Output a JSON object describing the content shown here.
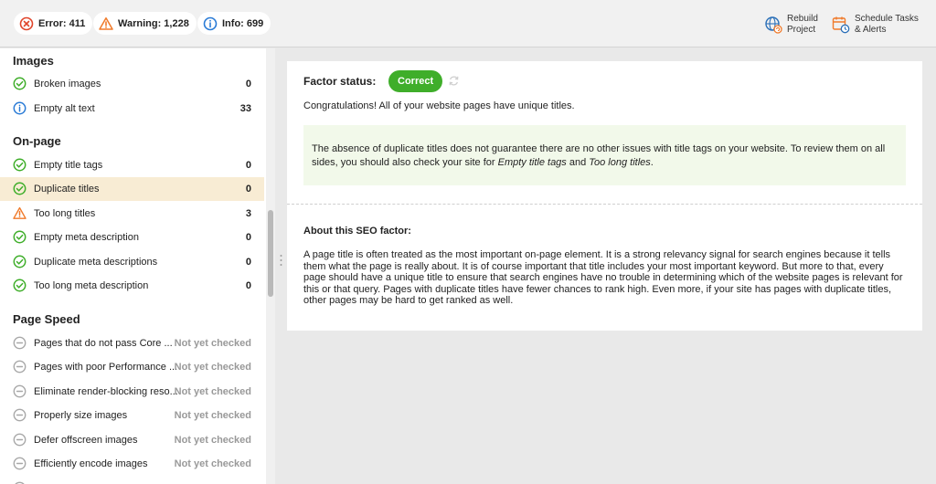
{
  "topbar": {
    "error": {
      "label": "Error: 411"
    },
    "warning": {
      "label": "Warning: 1,228"
    },
    "info": {
      "label": "Info: 699"
    },
    "rebuild": {
      "line1": "Rebuild",
      "line2": "Project",
      "icon": "globe-refresh-icon"
    },
    "schedule": {
      "line1": "Schedule Tasks",
      "line2": "& Alerts",
      "icon": "calendar-clock-icon"
    }
  },
  "sidebar": {
    "images": {
      "title": "Images",
      "items": [
        {
          "label": "Broken images",
          "count": "0",
          "status": "ok"
        },
        {
          "label": "Empty alt text",
          "count": "33",
          "status": "info"
        }
      ]
    },
    "onpage": {
      "title": "On-page",
      "items": [
        {
          "label": "Empty title tags",
          "count": "0",
          "status": "ok"
        },
        {
          "label": "Duplicate titles",
          "count": "0",
          "status": "ok"
        },
        {
          "label": "Too long titles",
          "count": "3",
          "status": "warning"
        },
        {
          "label": "Empty meta description",
          "count": "0",
          "status": "ok"
        },
        {
          "label": "Duplicate meta descriptions",
          "count": "0",
          "status": "ok"
        },
        {
          "label": "Too long meta description",
          "count": "0",
          "status": "ok"
        }
      ]
    },
    "pagespeed": {
      "title": "Page Speed",
      "items": [
        {
          "label": "Pages that do not pass Core ...",
          "count": "Not yet checked",
          "status": "pending"
        },
        {
          "label": "Pages with poor Performance ...",
          "count": "Not yet checked",
          "status": "pending"
        },
        {
          "label": "Eliminate render-blocking reso...",
          "count": "Not yet checked",
          "status": "pending"
        },
        {
          "label": "Properly size images",
          "count": "Not yet checked",
          "status": "pending"
        },
        {
          "label": "Defer offscreen images",
          "count": "Not yet checked",
          "status": "pending"
        },
        {
          "label": "Efficiently encode images",
          "count": "Not yet checked",
          "status": "pending"
        }
      ]
    }
  },
  "main": {
    "factor_label": "Factor status:",
    "status_badge": "Correct",
    "congrats": "Congratulations! All of your website pages have unique titles.",
    "note_text1": "The absence of duplicate titles does not guarantee there are no other issues with title tags on your website. To review them on all sides, you should also check your site for ",
    "note_link1": "Empty title tags",
    "note_and": " and ",
    "note_link2": "Too long titles",
    "note_end": ".",
    "about_title": "About this SEO factor:",
    "about_text": "A page title is often treated as the most important on-page element. It is a strong relevancy signal for search engines because it tells them what the page is really about. It is of course important that title includes your most important keyword. But more to that, every page should have a unique title to ensure that search engines have no trouble in determining which of the website pages is relevant for this or that query. Pages with duplicate titles have fewer chances to rank high. Even more, if your site has pages with duplicate titles, other pages may be hard to get ranked as well."
  },
  "colors": {
    "ok": "#3fae2a",
    "info": "#2a7bd6",
    "warning": "#f07a2a",
    "error": "#e0452b",
    "pending": "#a8a8a8",
    "selected_row": "#f8ecd4",
    "note_bg": "#f2f9ea"
  }
}
